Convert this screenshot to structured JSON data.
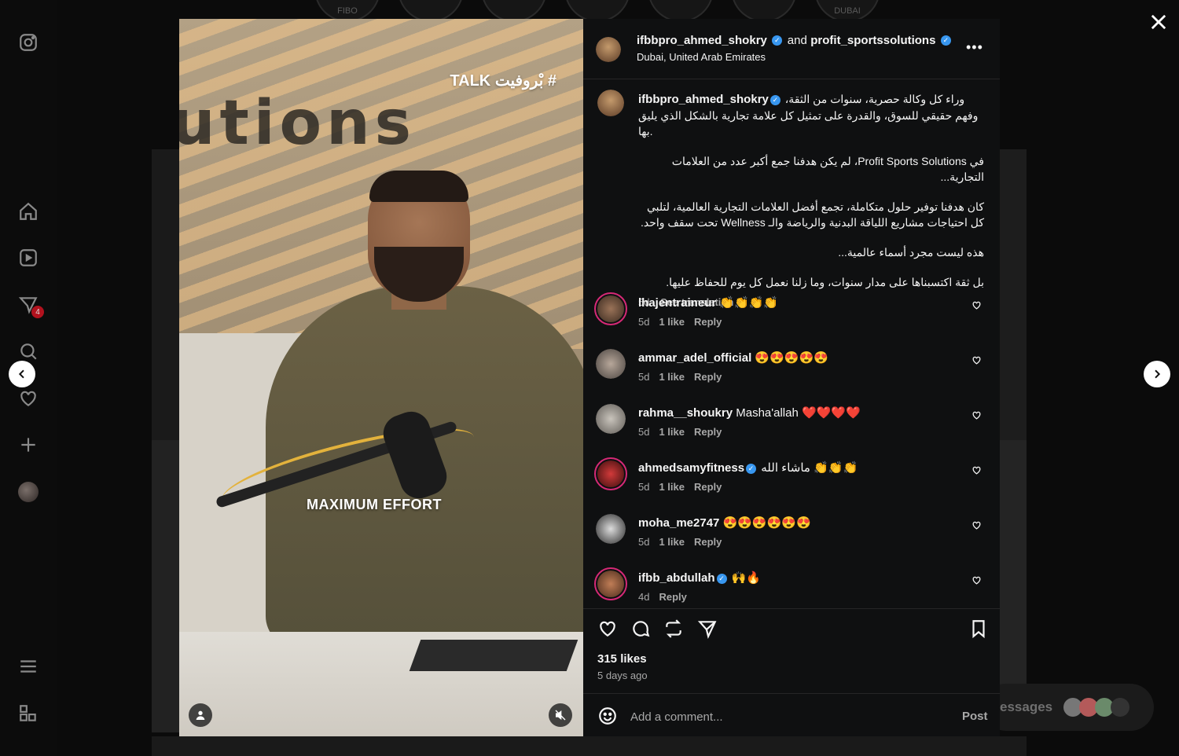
{
  "background": {
    "stories": [
      "FIBO",
      "",
      "",
      "",
      "",
      "",
      "DUBAI"
    ],
    "messages_label": "essages"
  },
  "sidebar": {
    "badge": "4"
  },
  "media": {
    "overlay_top": "TALK بْروفيت #",
    "overlay_mid": "MAXIMUM EFFORT",
    "sign_text": "utions"
  },
  "header": {
    "user1": "ifbbpro_ahmed_shokry",
    "joiner": "and",
    "user2": "profit_sportssolutions",
    "location": "Dubai, United Arab Emirates",
    "more": "•••"
  },
  "caption": {
    "user": "ifbbpro_ahmed_shokry",
    "line1": "وراء كل وكالة حصرية، سنوات من الثقة، وفهم حقيقي للسوق، والقدرة على تمثيل كل علامة تجارية بالشكل الذي يليق بها.",
    "line2": "في Profit Sports Solutions، لم يكن هدفنا جمع أكبر عدد من العلامات التجارية...",
    "line3": "كان هدفنا توفير حلول متكاملة، تجمع أفضل العلامات التجارية العالمية، لتلبي كل احتياجات مشاريع اللياقة البدنية والرياضة والـ Wellness تحت سقف واحد.",
    "line4": "هذه ليست مجرد أسماء عالمية...",
    "line5": "بل ثقة اكتسبناها على مدار سنوات، وما زلنا نعمل كل يوم للحفاظ عليها.",
    "age": "5d",
    "see_translation": "See translation"
  },
  "comments": [
    {
      "user": "lhajentraineur",
      "verified": false,
      "text": "👏👏👏👏",
      "age": "5d",
      "likes": "1 like",
      "reply": "Reply"
    },
    {
      "user": "ammar_adel_official",
      "verified": false,
      "text": "😍😍😍😍😍",
      "age": "5d",
      "likes": "1 like",
      "reply": "Reply"
    },
    {
      "user": "rahma__shoukry",
      "verified": false,
      "text": "Masha'allah ❤️❤️❤️❤️",
      "age": "5d",
      "likes": "1 like",
      "reply": "Reply"
    },
    {
      "user": "ahmedsamyfitness",
      "verified": true,
      "text": "ماشاء الله 👏👏👏",
      "age": "5d",
      "likes": "1 like",
      "reply": "Reply"
    },
    {
      "user": "moha_me2747",
      "verified": false,
      "text": "😍😍😍😍😍😍",
      "age": "5d",
      "likes": "1 like",
      "reply": "Reply"
    },
    {
      "user": "ifbb_abdullah",
      "verified": true,
      "text": "🙌🔥",
      "age": "4d",
      "likes": "",
      "reply": "Reply"
    }
  ],
  "stats": {
    "likes": "315 likes",
    "when": "5 days ago"
  },
  "composer": {
    "placeholder": "Add a comment...",
    "post": "Post"
  },
  "colors": {
    "accent": "#3897f0",
    "story_ring": "#d62976",
    "panel_bg": "#0f1011"
  }
}
